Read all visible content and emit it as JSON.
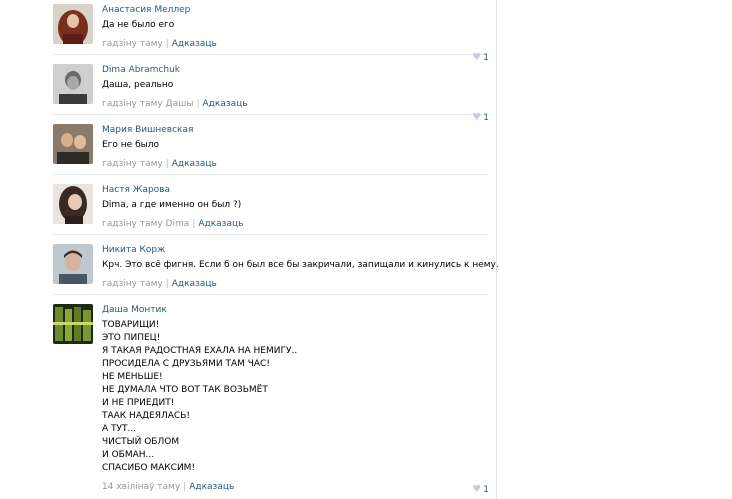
{
  "comments": [
    {
      "author": "Анастасия Меллер",
      "lines": [
        "Да не было его"
      ],
      "time": "гадзіну таму",
      "reply": "Адказаць",
      "likes": ""
    },
    {
      "author": "Dima Abramchuk",
      "lines": [
        "Даша, реально"
      ],
      "time": "гадзіну таму Дашы",
      "reply": "Адказаць",
      "likes": "1"
    },
    {
      "author": "Мария Вишневская",
      "lines": [
        "Его не было"
      ],
      "time": "гадзіну таму",
      "reply": "Адказаць",
      "likes": "1"
    },
    {
      "author": "Настя Жарова",
      "lines": [
        "Dima, а где именно он был ?)"
      ],
      "time": "гадзіну таму Dima",
      "reply": "Адказаць",
      "likes": ""
    },
    {
      "author": "Никита Корж",
      "lines": [
        "Крч. Это всё фигня. Если б он был все бы закричали, запищали и кинулись к нему."
      ],
      "time": "гадзіну таму",
      "reply": "Адказаць",
      "likes": ""
    },
    {
      "author": "Даша Монтик",
      "lines": [
        "ТОВАРИЩИ!",
        "ЭТО ПИПЕЦ!",
        "Я ТАКАЯ РАДОСТНАЯ ЕХАЛА НА НЕМИГУ..",
        "ПРОСИДЕЛА С ДРУЗЬЯМИ ТАМ ЧАС!",
        "НЕ МЕНЬШЕ!",
        "НЕ ДУМАЛА ЧТО ВОТ ТАК ВОЗЬМЁТ",
        "И НЕ ПРИЕДИТ!",
        "ТААК НАДЕЯЛАСЬ!",
        "А ТУТ...",
        "ЧИСТЫЙ ОБЛОМ",
        "И ОБМАН...",
        "СПАСИБО МАКСИМ!"
      ],
      "time": "14 хвілінаў таму",
      "reply": "Адказаць",
      "likes": "1"
    }
  ],
  "colors": {
    "link": "#2b587a",
    "meta": "#999999",
    "heart": "#c5cedb",
    "divider": "#e7eaed"
  },
  "icons": {
    "like": "heart-icon"
  }
}
